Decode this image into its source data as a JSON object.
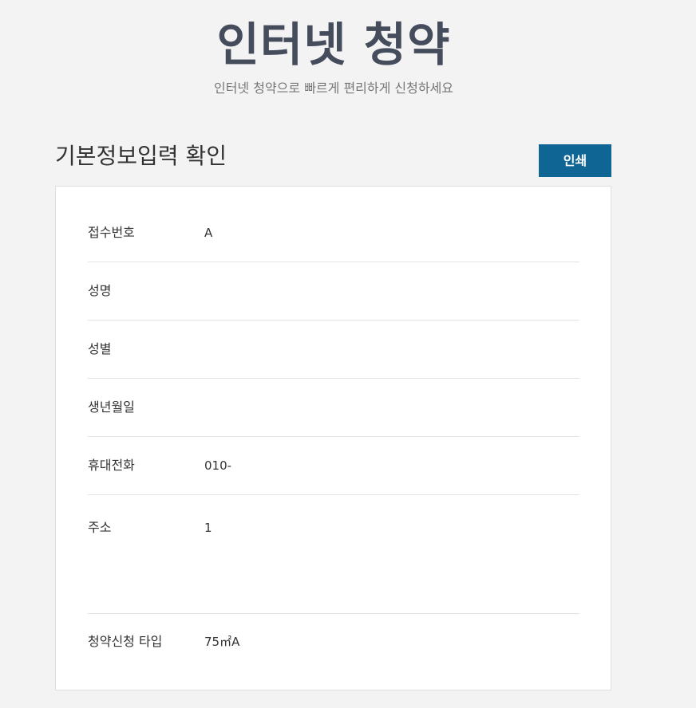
{
  "header": {
    "title": "인터넷 청약",
    "subtitle": "인터넷 청약으로 빠르게 편리하게 신청하세요"
  },
  "section": {
    "title": "기본정보입력 확인",
    "print_label": "인쇄"
  },
  "info_rows": [
    {
      "label": "접수번호",
      "value": "A"
    },
    {
      "label": "성명",
      "value": ""
    },
    {
      "label": "성별",
      "value": ""
    },
    {
      "label": "생년월일",
      "value": ""
    },
    {
      "label": "휴대전화",
      "value": "010-"
    },
    {
      "label": "주소",
      "value": "1"
    },
    {
      "label": "청약신청 타입",
      "value": "75㎡A"
    }
  ],
  "colors": {
    "accent": "#0f6594",
    "hero_title": "#454c5c",
    "background": "#f3f3f3"
  }
}
